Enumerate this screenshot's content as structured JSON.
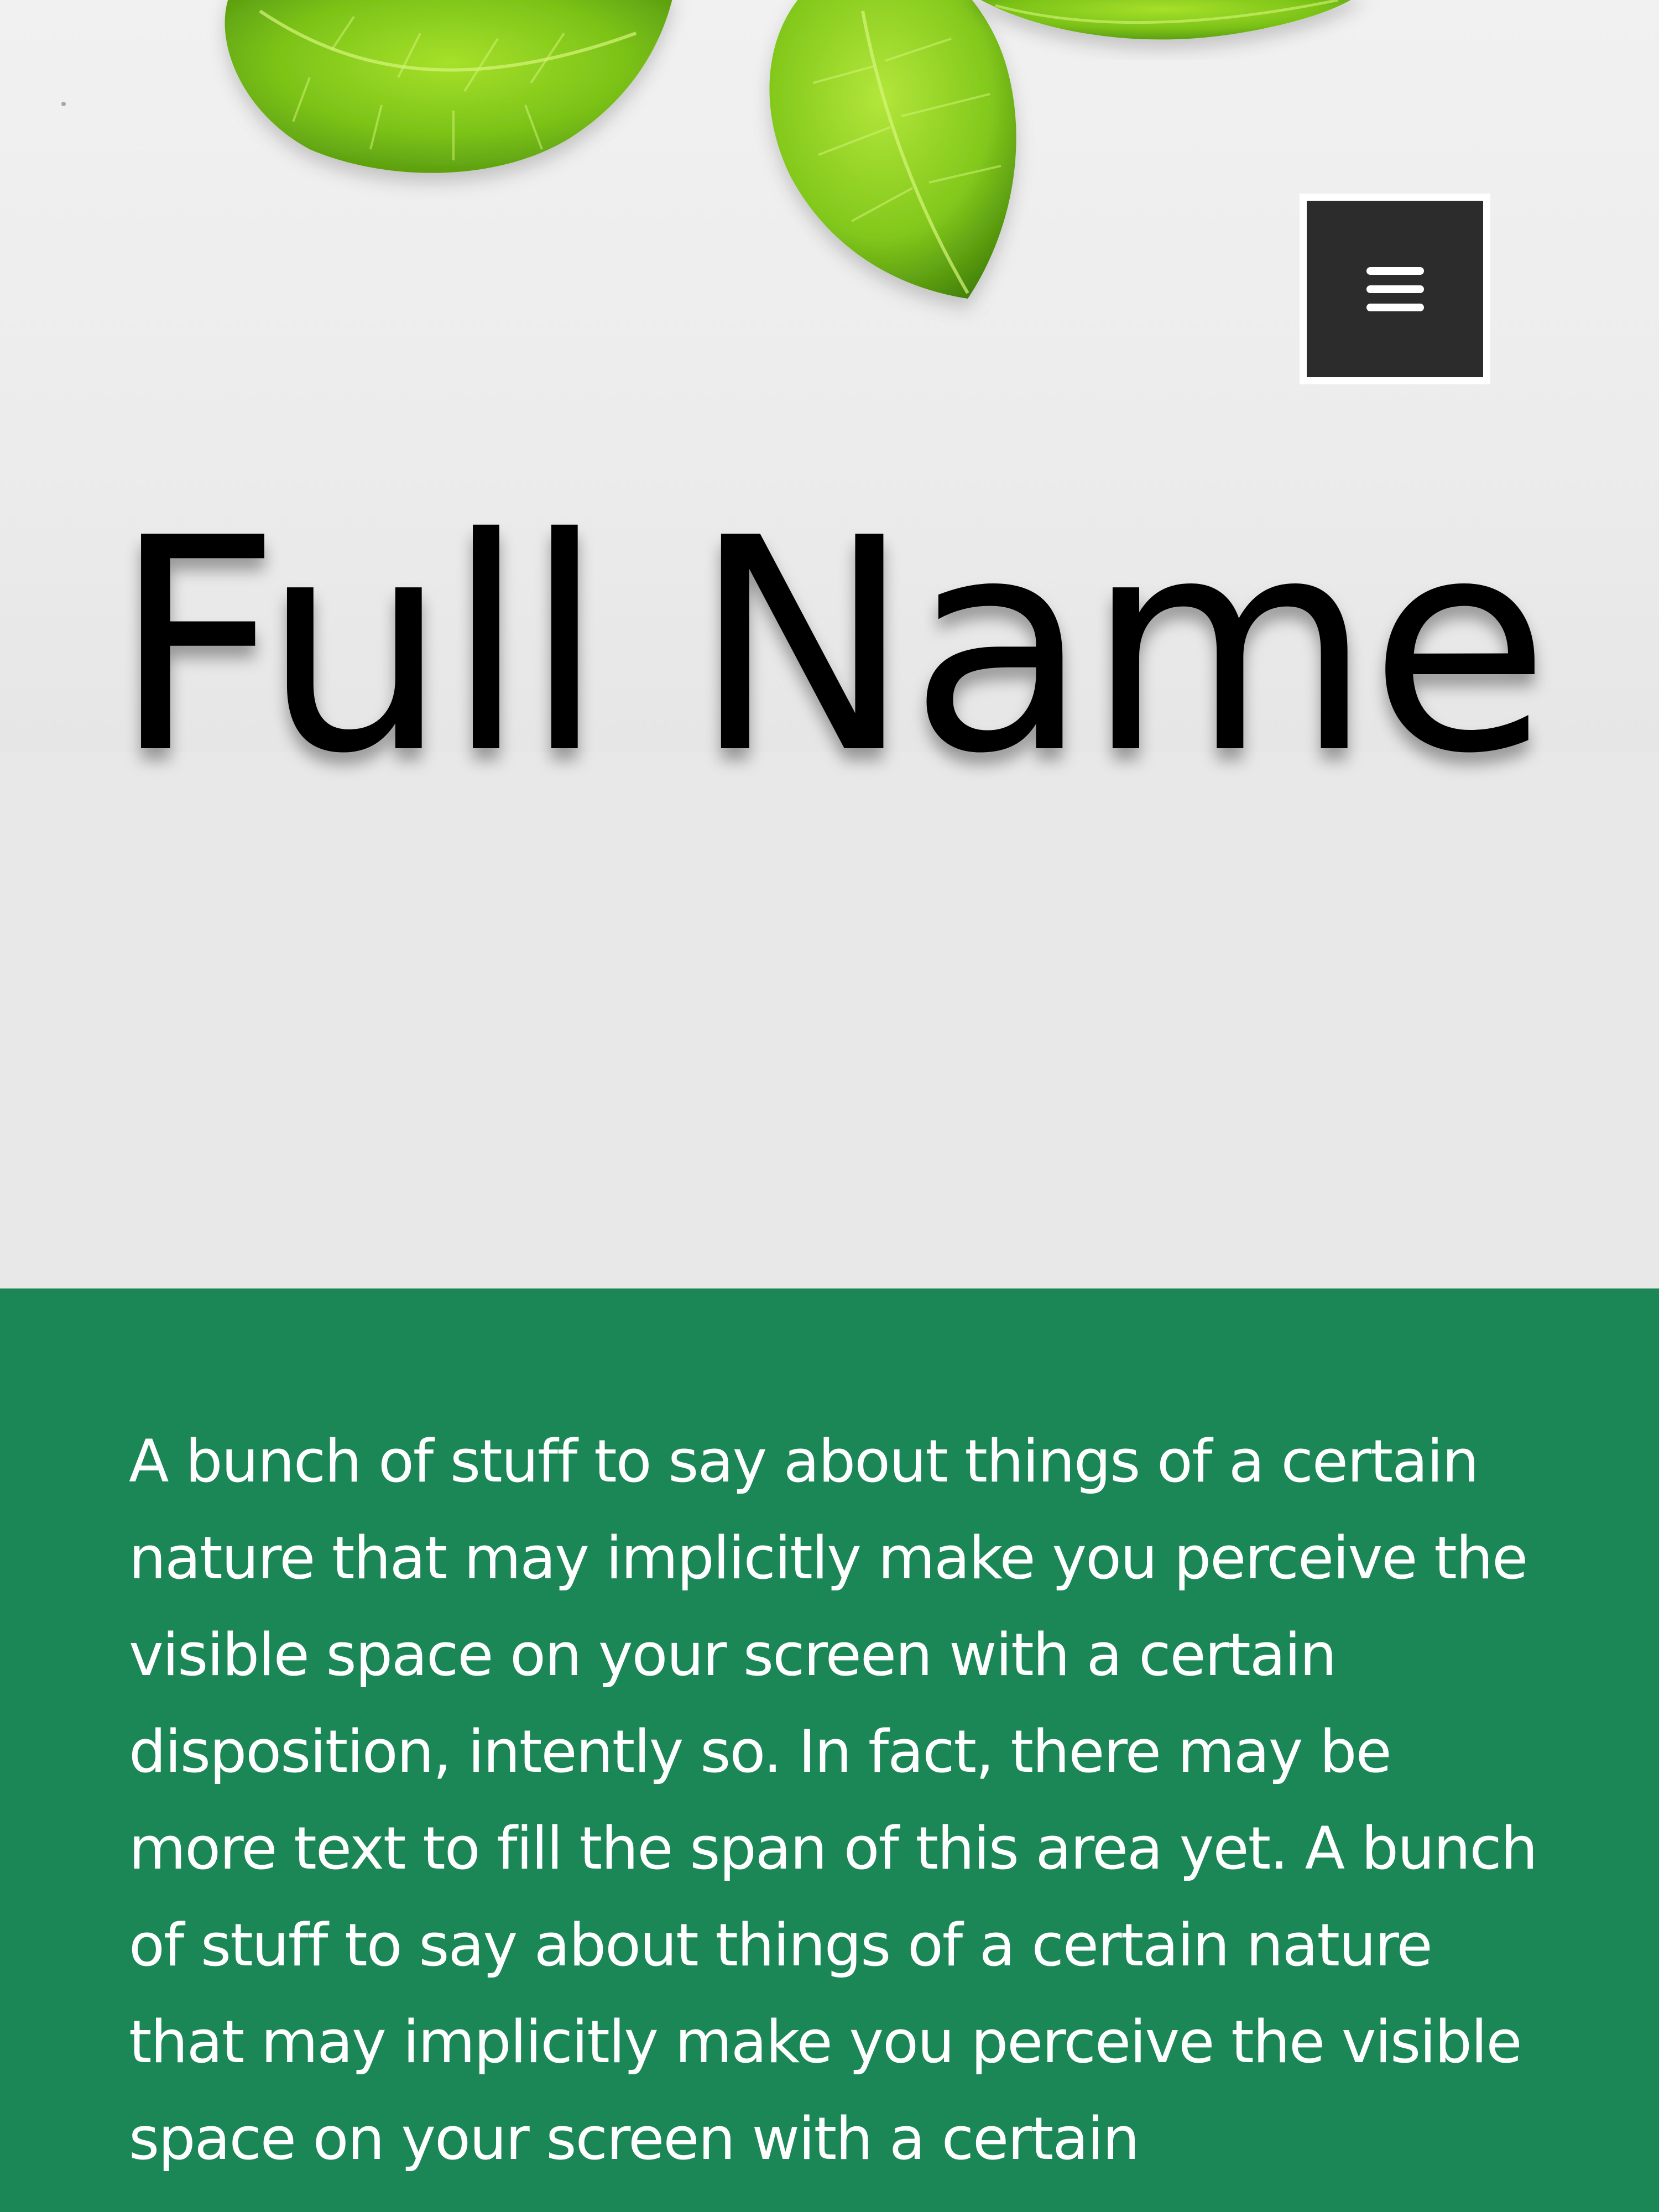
{
  "header": {
    "menu_button_label": "Open menu",
    "menu_icon": "hamburger-menu-icon",
    "hero_image": "mint-leaves-photo"
  },
  "hero": {
    "title": "Full Name"
  },
  "about": {
    "text": "A bunch of stuff to say about things of a certain nature that may implicitly make you perceive the visible space on your screen with a certain disposition, intently so. In fact, there may be more text to fill the span of this area yet. A bunch of stuff to say about things of a certain nature that may implicitly make you perceive the visible space on your screen with a certain"
  },
  "colors": {
    "hero_background": "#e8e8e8",
    "menu_button_background": "#2c2c2c",
    "menu_button_border": "#ffffff",
    "about_background": "#1b8756",
    "about_text": "#ffffff",
    "title_text": "#000000",
    "leaf_green": "#7cc318"
  }
}
